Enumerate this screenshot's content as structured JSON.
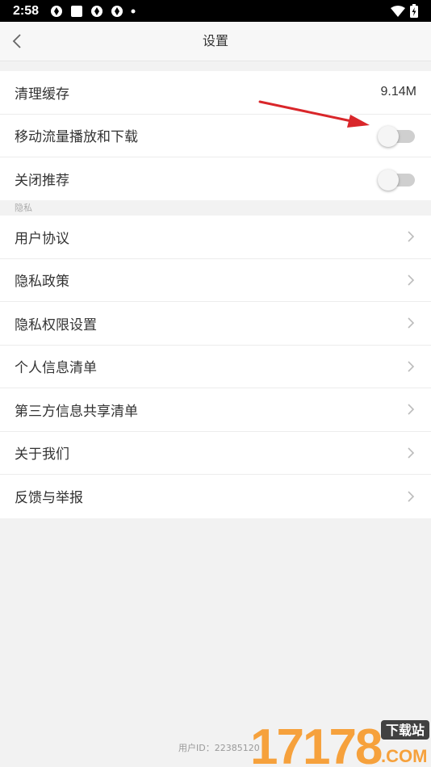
{
  "status_bar": {
    "time": "2:58",
    "icons": [
      "sync-icon",
      "square-icon",
      "sync-icon",
      "sync-icon",
      "dot-icon"
    ],
    "right_icons": [
      "wifi-icon",
      "battery-charging-icon"
    ]
  },
  "nav": {
    "title": "设置"
  },
  "general": {
    "clear_cache_label": "清理缓存",
    "clear_cache_value": "9.14M",
    "mobile_data_label": "移动流量播放和下载",
    "mobile_data_on": false,
    "recommend_label": "关闭推荐",
    "recommend_on": false
  },
  "privacy": {
    "section_label": "隐私",
    "items": [
      {
        "label": "用户协议"
      },
      {
        "label": "隐私政策"
      },
      {
        "label": "隐私权限设置"
      },
      {
        "label": "个人信息清单"
      },
      {
        "label": "第三方信息共享清单"
      },
      {
        "label": "关于我们"
      },
      {
        "label": "反馈与举报"
      }
    ]
  },
  "footer": {
    "user_id": "用户ID：22385120"
  },
  "watermark": {
    "text": "17178",
    "badge": "下载站",
    "domain": ".COM"
  },
  "colors": {
    "annotation_arrow": "#d9262a",
    "watermark_orange": "#f7941d"
  }
}
